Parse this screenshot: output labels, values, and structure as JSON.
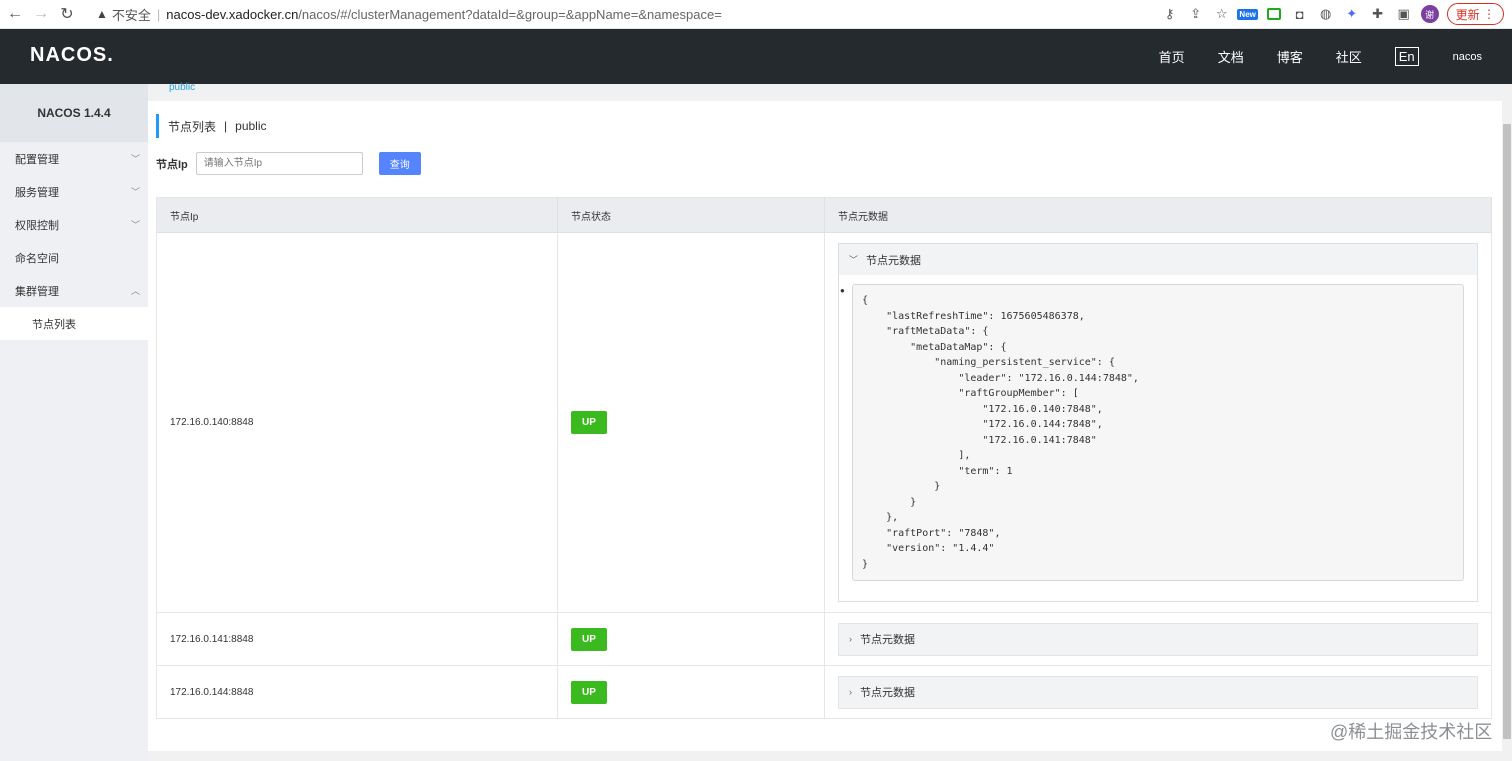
{
  "browser": {
    "insecure_label": "不安全",
    "url_host": "nacos-dev.xadocker.cn",
    "url_path": "/nacos/#/clusterManagement?dataId=&group=&appName=&namespace=",
    "new_badge": "New",
    "profile_initial": "谢",
    "update_label": "更新",
    "more_icon": "⋮"
  },
  "topbar": {
    "logo": "NACOS.",
    "nav": [
      "首页",
      "文档",
      "博客",
      "社区"
    ],
    "lang": "En",
    "user": "nacos"
  },
  "sidebar": {
    "title": "NACOS 1.4.4",
    "items": [
      {
        "label": "配置管理",
        "chevron": "down"
      },
      {
        "label": "服务管理",
        "chevron": "down"
      },
      {
        "label": "权限控制",
        "chevron": "down"
      },
      {
        "label": "命名空间",
        "chevron": ""
      },
      {
        "label": "集群管理",
        "chevron": "up"
      }
    ],
    "sub_items": [
      "节点列表"
    ]
  },
  "main": {
    "breadcrumb": "public",
    "title": "节点列表",
    "title_sep": "|",
    "namespace": "public",
    "filter_label": "节点Ip",
    "filter_placeholder": "请输入节点Ip",
    "search_button": "查询",
    "columns": [
      "节点Ip",
      "节点状态",
      "节点元数据"
    ],
    "rows": [
      {
        "ip": "172.16.0.140:8848",
        "status": "UP",
        "meta_label": "节点元数据",
        "expanded": true
      },
      {
        "ip": "172.16.0.141:8848",
        "status": "UP",
        "meta_label": "节点元数据",
        "expanded": false
      },
      {
        "ip": "172.16.0.144:8848",
        "status": "UP",
        "meta_label": "节点元数据",
        "expanded": false
      }
    ],
    "metadata_json": "{\n    \"lastRefreshTime\": 1675605486378,\n    \"raftMetaData\": {\n        \"metaDataMap\": {\n            \"naming_persistent_service\": {\n                \"leader\": \"172.16.0.144:7848\",\n                \"raftGroupMember\": [\n                    \"172.16.0.140:7848\",\n                    \"172.16.0.144:7848\",\n                    \"172.16.0.141:7848\"\n                ],\n                \"term\": 1\n            }\n        }\n    },\n    \"raftPort\": \"7848\",\n    \"version\": \"1.4.4\"\n}"
  },
  "watermark": "@稀土掘金技术社区"
}
